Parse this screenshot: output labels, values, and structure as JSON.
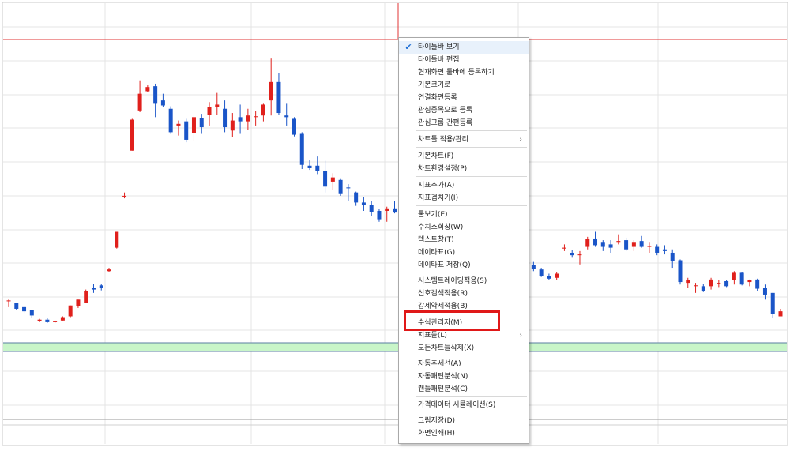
{
  "colors": {
    "up": "#e0201c",
    "down": "#1a55c8",
    "grid": "#e4e4e4",
    "band": "#c8f5c8",
    "band_line": "#5a7ea0",
    "red_line": "#e03434",
    "highlight": "#e01818"
  },
  "chart_data": {
    "type": "candlestick",
    "ohlc": [
      [
        60,
        62,
        53,
        61
      ],
      [
        58,
        58,
        50,
        51
      ],
      [
        53,
        54,
        46,
        48
      ],
      [
        50,
        50,
        40,
        43
      ],
      [
        36,
        39,
        35,
        38
      ],
      [
        38,
        40,
        34,
        35
      ],
      [
        35,
        37,
        34,
        36
      ],
      [
        37,
        42,
        37,
        41
      ],
      [
        42,
        55,
        41,
        55
      ],
      [
        54,
        62,
        52,
        62
      ],
      [
        58,
        74,
        58,
        72
      ],
      [
        76,
        81,
        70,
        74
      ],
      [
        79,
        81,
        73,
        76
      ],
      [
        96,
        100,
        95,
        98
      ],
      [
        124,
        143,
        123,
        143
      ],
      [
        186,
        190,
        183,
        186
      ],
      [
        240,
        278,
        240,
        277
      ],
      [
        288,
        324,
        286,
        308
      ],
      [
        311,
        318,
        310,
        316
      ],
      [
        317,
        320,
        280,
        296
      ],
      [
        300,
        308,
        292,
        294
      ],
      [
        290,
        293,
        260,
        262
      ],
      [
        270,
        276,
        258,
        272
      ],
      [
        275,
        278,
        250,
        253
      ],
      [
        261,
        282,
        252,
        280
      ],
      [
        279,
        284,
        260,
        268
      ],
      [
        283,
        298,
        270,
        292
      ],
      [
        292,
        309,
        283,
        295
      ],
      [
        290,
        300,
        262,
        268
      ],
      [
        264,
        285,
        256,
        276
      ],
      [
        280,
        295,
        260,
        275
      ],
      [
        275,
        290,
        265,
        282
      ],
      [
        281,
        287,
        270,
        281
      ],
      [
        282,
        296,
        275,
        295
      ],
      [
        300,
        350,
        282,
        322
      ],
      [
        322,
        333,
        283,
        285
      ],
      [
        282,
        296,
        270,
        280
      ],
      [
        278,
        280,
        257,
        259
      ],
      [
        260,
        262,
        218,
        223
      ],
      [
        222,
        229,
        217,
        219
      ],
      [
        222,
        233,
        212,
        216
      ],
      [
        216,
        228,
        190,
        197
      ],
      [
        203,
        213,
        193,
        208
      ],
      [
        205,
        207,
        186,
        189
      ],
      [
        196,
        200,
        180,
        195
      ],
      [
        190,
        191,
        174,
        178
      ],
      [
        178,
        185,
        168,
        175
      ],
      [
        175,
        180,
        162,
        167
      ],
      [
        168,
        170,
        155,
        158
      ],
      [
        168,
        173,
        155,
        171
      ],
      [
        171,
        180,
        165,
        166
      ],
      [
        166,
        172,
        160,
        162
      ],
      [
        162,
        183,
        160,
        180
      ],
      [
        174,
        185,
        170,
        180
      ],
      [
        180,
        186,
        167,
        169
      ],
      [
        178,
        182,
        164,
        175
      ],
      [
        178,
        181,
        168,
        175
      ],
      [
        174,
        176,
        162,
        164
      ],
      [
        165,
        168,
        160,
        167
      ],
      [
        168,
        170,
        156,
        158
      ],
      [
        159,
        163,
        140,
        144
      ],
      [
        145,
        147,
        136,
        139
      ],
      [
        135,
        137,
        125,
        131
      ],
      [
        129,
        134,
        124,
        126
      ],
      [
        126,
        128,
        104,
        110
      ],
      [
        116,
        121,
        112,
        114
      ],
      [
        108,
        112,
        98,
        103
      ],
      [
        102,
        104,
        96,
        100
      ],
      [
        103,
        107,
        96,
        99
      ],
      [
        98,
        100,
        89,
        90
      ],
      [
        90,
        93,
        85,
        87
      ],
      [
        88,
        95,
        85,
        93
      ],
      [
        123,
        128,
        120,
        124
      ],
      [
        118,
        121,
        112,
        115
      ],
      [
        115,
        120,
        104,
        116
      ],
      [
        125,
        137,
        122,
        134
      ],
      [
        135,
        143,
        125,
        127
      ],
      [
        130,
        133,
        120,
        125
      ],
      [
        128,
        133,
        118,
        124
      ],
      [
        130,
        140,
        128,
        132
      ],
      [
        133,
        136,
        120,
        122
      ],
      [
        125,
        133,
        120,
        130
      ],
      [
        132,
        138,
        124,
        125
      ],
      [
        125,
        130,
        118,
        126
      ],
      [
        125,
        128,
        115,
        118
      ],
      [
        122,
        127,
        116,
        120
      ],
      [
        118,
        122,
        100,
        108
      ],
      [
        109,
        110,
        80,
        83
      ],
      [
        82,
        88,
        76,
        85
      ],
      [
        79,
        82,
        70,
        79
      ],
      [
        78,
        81,
        71,
        72
      ],
      [
        78,
        88,
        74,
        86
      ],
      [
        82,
        85,
        77,
        82
      ],
      [
        84,
        85,
        77,
        78
      ],
      [
        85,
        96,
        80,
        94
      ],
      [
        94,
        95,
        79,
        80
      ],
      [
        83,
        86,
        78,
        85
      ],
      [
        86,
        87,
        72,
        75
      ],
      [
        76,
        80,
        62,
        68
      ],
      [
        70,
        70,
        40,
        45
      ],
      [
        42,
        51,
        43,
        48
      ]
    ],
    "ylim": [
      0,
      420
    ]
  },
  "context_menu": {
    "items": [
      {
        "label": "타이틀바 보기",
        "checked": true
      },
      {
        "label": "타이틀바 편집"
      },
      {
        "label": "현재화면 툴바에 등록하기"
      },
      {
        "label": "기본크기로"
      },
      {
        "label": "연결화면등록"
      },
      {
        "label": "관심종목으로 등록"
      },
      {
        "label": "관심그룹 간편등록"
      },
      {
        "label": "차트툴 적용/관리",
        "submenu": true
      },
      {
        "label": "기본차트(F)"
      },
      {
        "label": "차트환경설정(P)"
      },
      {
        "label": "지표추가(A)"
      },
      {
        "label": "지표겹치기(I)"
      },
      {
        "label": "툴보기(E)"
      },
      {
        "label": "수치조회창(W)"
      },
      {
        "label": "텍스트창(T)"
      },
      {
        "label": "데이타표(G)"
      },
      {
        "label": "데이타표 저장(Q)"
      },
      {
        "label": "시스템트레이딩적용(S)"
      },
      {
        "label": "신호검색적용(R)"
      },
      {
        "label": "강세약세적용(B)"
      },
      {
        "label": "수식관리자(M)"
      },
      {
        "label": "지표들(L)",
        "submenu": true
      },
      {
        "label": "모든차트들삭제(X)"
      },
      {
        "label": "자동추세선(A)"
      },
      {
        "label": "자동패턴분석(N)"
      },
      {
        "label": "캔들패턴분석(C)"
      },
      {
        "label": "가격데이터 시뮬레이션(S)"
      },
      {
        "label": "그림저장(D)"
      },
      {
        "label": "화면인쇄(H)"
      }
    ],
    "check_icon": "checkmark-icon",
    "submenu_icon": "chevron-right-icon",
    "submenu_glyph": "›",
    "check_glyph": "✔"
  }
}
